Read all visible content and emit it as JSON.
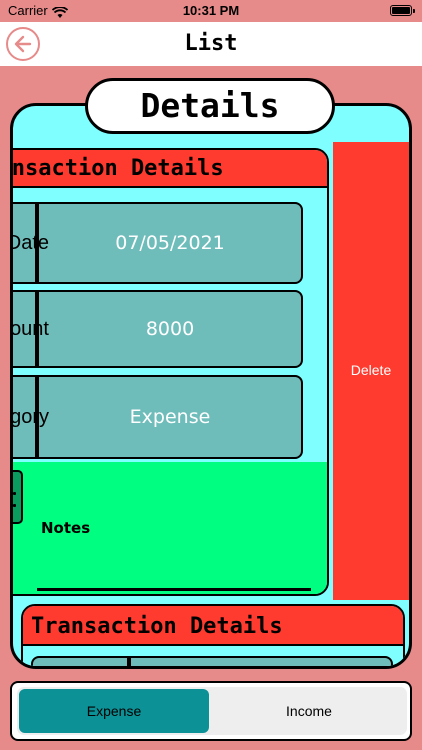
{
  "status_bar": {
    "carrier": "Carrier",
    "time": "10:31 PM"
  },
  "navbar": {
    "title": "List"
  },
  "card": {
    "heading": "Details"
  },
  "transaction_1": {
    "header": "Transaction Details",
    "fields": [
      {
        "label": "Date",
        "value": "07/05/2021"
      },
      {
        "label": "Amount",
        "value": "8000"
      },
      {
        "label": "Category",
        "value": "Expense"
      }
    ],
    "notes_label": "Notes",
    "delete_label": "Delete"
  },
  "transaction_2": {
    "header": "Transaction Details"
  },
  "segment": {
    "options": [
      "Expense",
      "Income"
    ],
    "selected": "Expense"
  },
  "colors": {
    "background": "#e68a8a",
    "card": "#7fffff",
    "header": "#ff3b2f",
    "field": "#6fbdbb",
    "notes": "#00ff80",
    "segment_selected": "#0c9196"
  }
}
